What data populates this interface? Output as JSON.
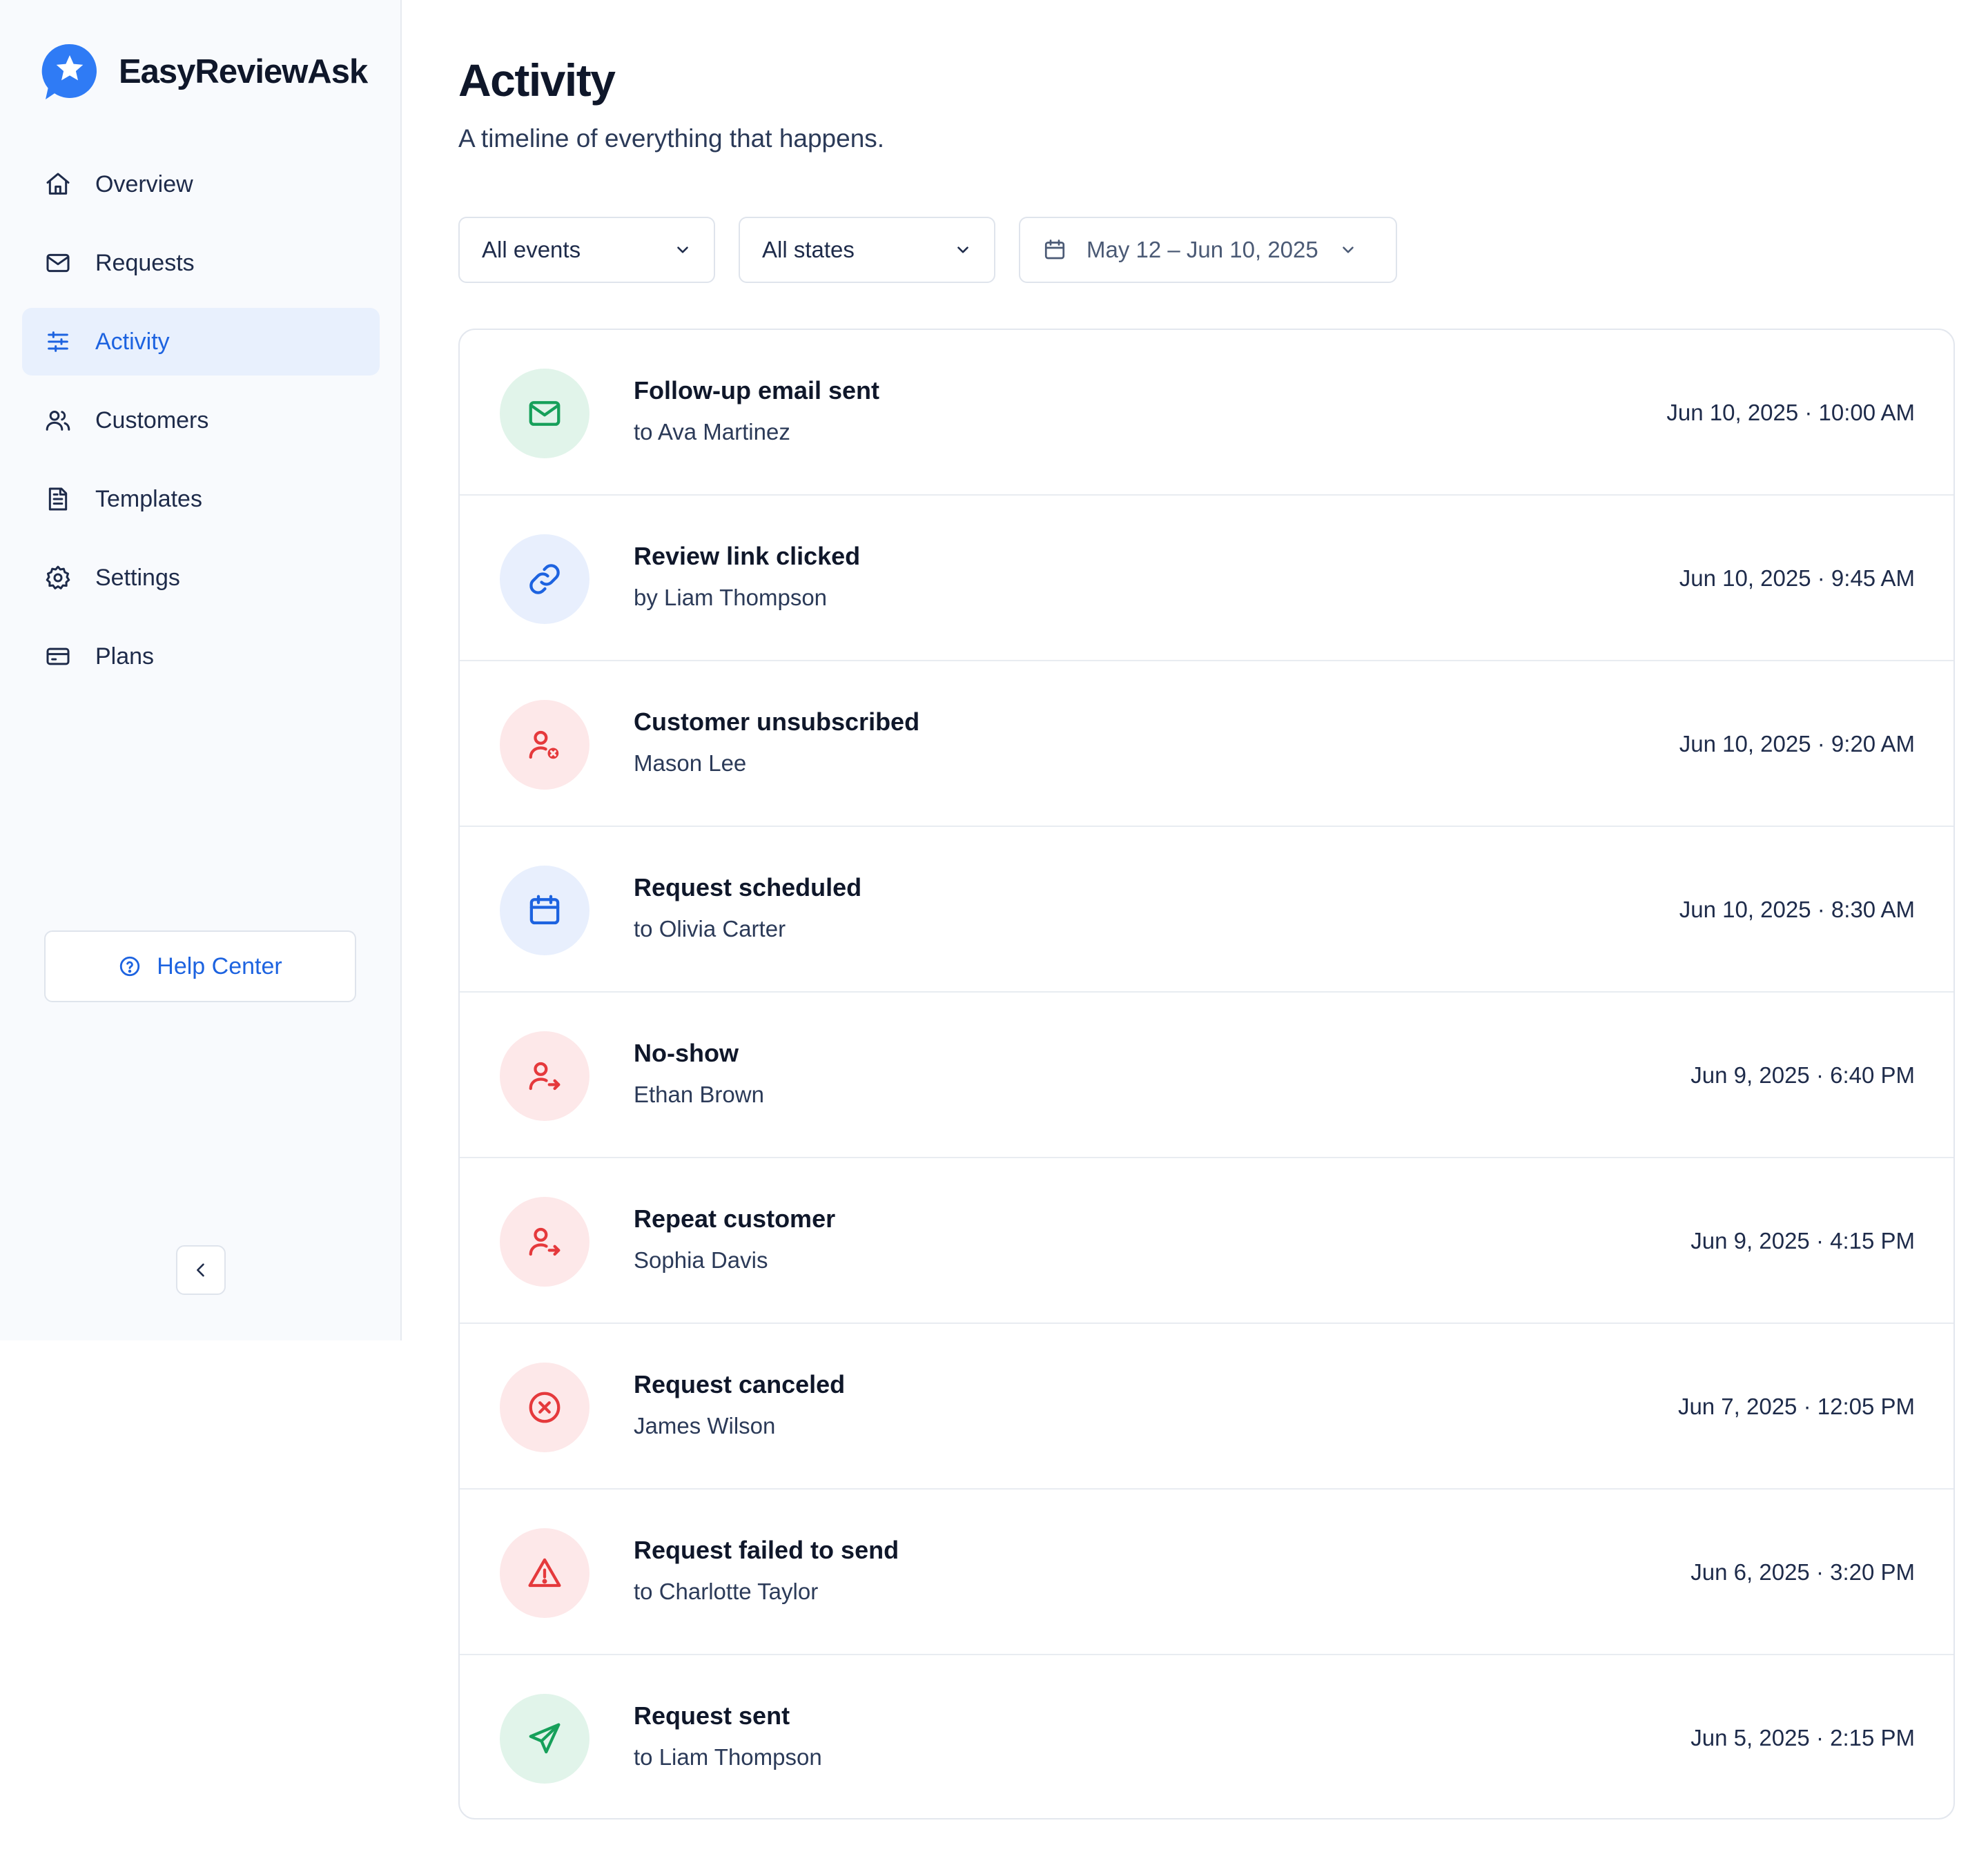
{
  "brand": {
    "name": "EasyReviewAsk",
    "accent": "#2f7bf5"
  },
  "nav": [
    {
      "label": "Overview",
      "icon": "home-icon",
      "active": false
    },
    {
      "label": "Requests",
      "icon": "mail-icon",
      "active": false
    },
    {
      "label": "Activity",
      "icon": "sliders-icon",
      "active": true
    },
    {
      "label": "Customers",
      "icon": "users-icon",
      "active": false
    },
    {
      "label": "Templates",
      "icon": "document-icon",
      "active": false
    },
    {
      "label": "Settings",
      "icon": "gear-icon",
      "active": false
    },
    {
      "label": "Plans",
      "icon": "credit-card-icon",
      "active": false
    }
  ],
  "help": {
    "label": "Help Center",
    "icon": "question-circle-icon"
  },
  "collapse": {
    "icon": "chevron-left-icon"
  },
  "page": {
    "title": "Activity",
    "subtitle": "A timeline of everything that happens."
  },
  "filters": {
    "events": "All events",
    "states": "All states",
    "date_range": "May 12 – Jun 10, 2025"
  },
  "colors": {
    "green": "#16a05a",
    "blue": "#1d63e0",
    "red": "#e5393c"
  },
  "activities": [
    {
      "title": "Follow-up email sent",
      "subtitle": "to Ava Martinez",
      "time": "Jun 10, 2025 · 10:00 AM",
      "icon": "mail-icon",
      "tone": "green"
    },
    {
      "title": "Review link clicked",
      "subtitle": "by Liam Thompson",
      "time": "Jun 10, 2025 · 9:45 AM",
      "icon": "link-icon",
      "tone": "blue"
    },
    {
      "title": "Customer unsubscribed",
      "subtitle": "Mason Lee",
      "time": "Jun 10, 2025 · 9:20 AM",
      "icon": "user-x-icon",
      "tone": "red"
    },
    {
      "title": "Request scheduled",
      "subtitle": "to Olivia Carter",
      "time": "Jun 10, 2025 · 8:30 AM",
      "icon": "calendar-icon",
      "tone": "blue"
    },
    {
      "title": "No-show",
      "subtitle": "Ethan Brown",
      "time": "Jun 9, 2025 · 6:40 PM",
      "icon": "user-arrow-icon",
      "tone": "red"
    },
    {
      "title": "Repeat customer",
      "subtitle": "Sophia Davis",
      "time": "Jun 9, 2025 · 4:15 PM",
      "icon": "user-arrow-icon",
      "tone": "red"
    },
    {
      "title": "Request canceled",
      "subtitle": "James Wilson",
      "time": "Jun 7, 2025 · 12:05 PM",
      "icon": "x-circle-icon",
      "tone": "red"
    },
    {
      "title": "Request failed to send",
      "subtitle": "to Charlotte Taylor",
      "time": "Jun 6, 2025 · 3:20 PM",
      "icon": "warning-icon",
      "tone": "red"
    },
    {
      "title": "Request sent",
      "subtitle": "to Liam Thompson",
      "time": "Jun 5, 2025 · 2:15 PM",
      "icon": "send-icon",
      "tone": "green"
    }
  ]
}
